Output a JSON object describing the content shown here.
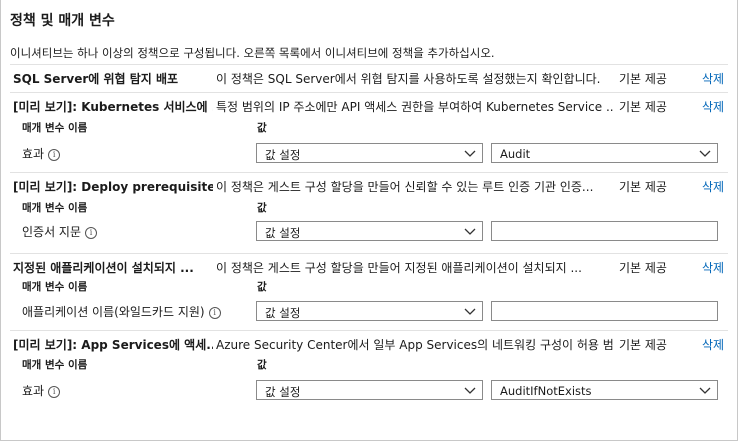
{
  "title": "정책 및 매개 변수",
  "description": "이니셔티브는 하나 이상의 정책으로 구성됩니다. 오른쪽 목록에서 이니셔티브에 정책을 추가하십시오.",
  "param_header": "매개 변수 이름",
  "value_header": "값",
  "delete_label": "삭제",
  "policies": [
    {
      "name": "SQL Server에 위협 탐지 배포",
      "desc": "이 정책은 SQL Server에서 위협 탐지를 사용하도록 설정했는지 확인합니다.",
      "type": "기본 제공"
    },
    {
      "name": "[미리 보기]: Kubernetes 서비스에 ...",
      "desc": "특정 범위의 IP 주소에만 API 액세스 권한을 부여하여 Kubernetes Service ...",
      "type": "기본 제공",
      "param": "효과",
      "select": "값 설정",
      "value": "Audit"
    },
    {
      "name": "[미리 보기]: Deploy prerequisites...",
      "desc": "이 정책은 게스트 구성 할당을 만들어 신뢰할 수 있는 루트 인증 기관 인증...",
      "type": "기본 제공",
      "param": "인증서 지문",
      "select": "값 설정",
      "value": ""
    },
    {
      "name": "지정된 애플리케이션이 설치되지 ...",
      "desc": "이 정책은 게스트 구성 할당을 만들어 지정된 애플리케이션이 설치되지 ...",
      "type": "기본 제공",
      "param": "애플리케이션 이름(와일드카드 지원)",
      "select": "값 설정",
      "value": ""
    },
    {
      "name": "[미리 보기]: App Services에 액세...",
      "desc": "Azure Security Center에서 일부 App Services의 네트워킹 구성이 허용 범...",
      "type": "기본 제공",
      "param": "효과",
      "select": "값 설정",
      "value": "AuditIfNotExists"
    }
  ]
}
